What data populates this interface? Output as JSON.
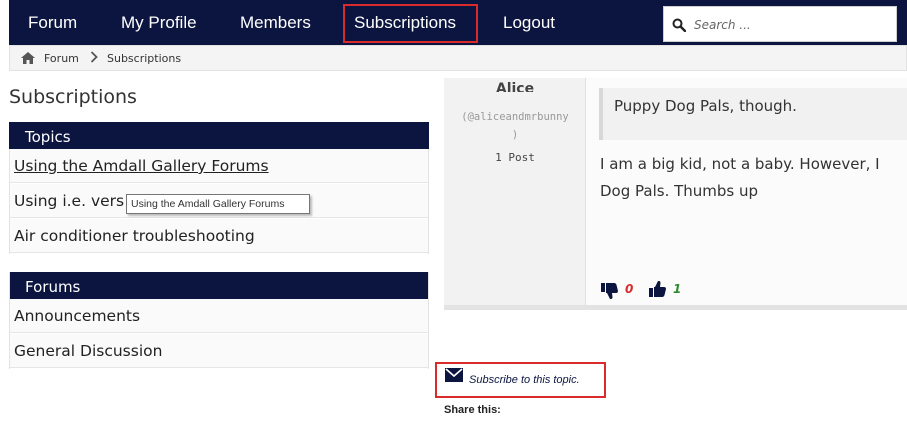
{
  "nav": {
    "items": [
      "Forum",
      "My Profile",
      "Members",
      "Subscriptions",
      "Logout"
    ],
    "active": "Subscriptions",
    "search_placeholder": "Search ..."
  },
  "breadcrumb": {
    "items": [
      "Forum",
      "Subscriptions"
    ]
  },
  "page_title": "Subscriptions",
  "topics": {
    "header": "Topics",
    "items": [
      "Using the Amdall Gallery Forums",
      "Using i.e. vers",
      "Air conditioner troubleshooting"
    ]
  },
  "tooltip": "Using the Amdall Gallery Forums",
  "forums": {
    "header": "Forums",
    "items": [
      "Announcements",
      "General Discussion"
    ]
  },
  "post": {
    "author_name": "Alice",
    "handle_line1": "(@aliceandmrbunny",
    "handle_line2": ")",
    "post_count": "1 Post",
    "quote": "Puppy Dog Pals, though.",
    "body_line1": "I am a big kid, not a baby. However, I",
    "body_line2": "Dog Pals. Thumbs up",
    "dislikes": "0",
    "likes": "1"
  },
  "subscribe_label": "Subscribe to this topic.",
  "share_label": "Share this:",
  "colors": {
    "navy": "#0c1540",
    "highlight": "#d92b2b",
    "dislike": "#d92b2b",
    "like": "#2e8b2e"
  }
}
